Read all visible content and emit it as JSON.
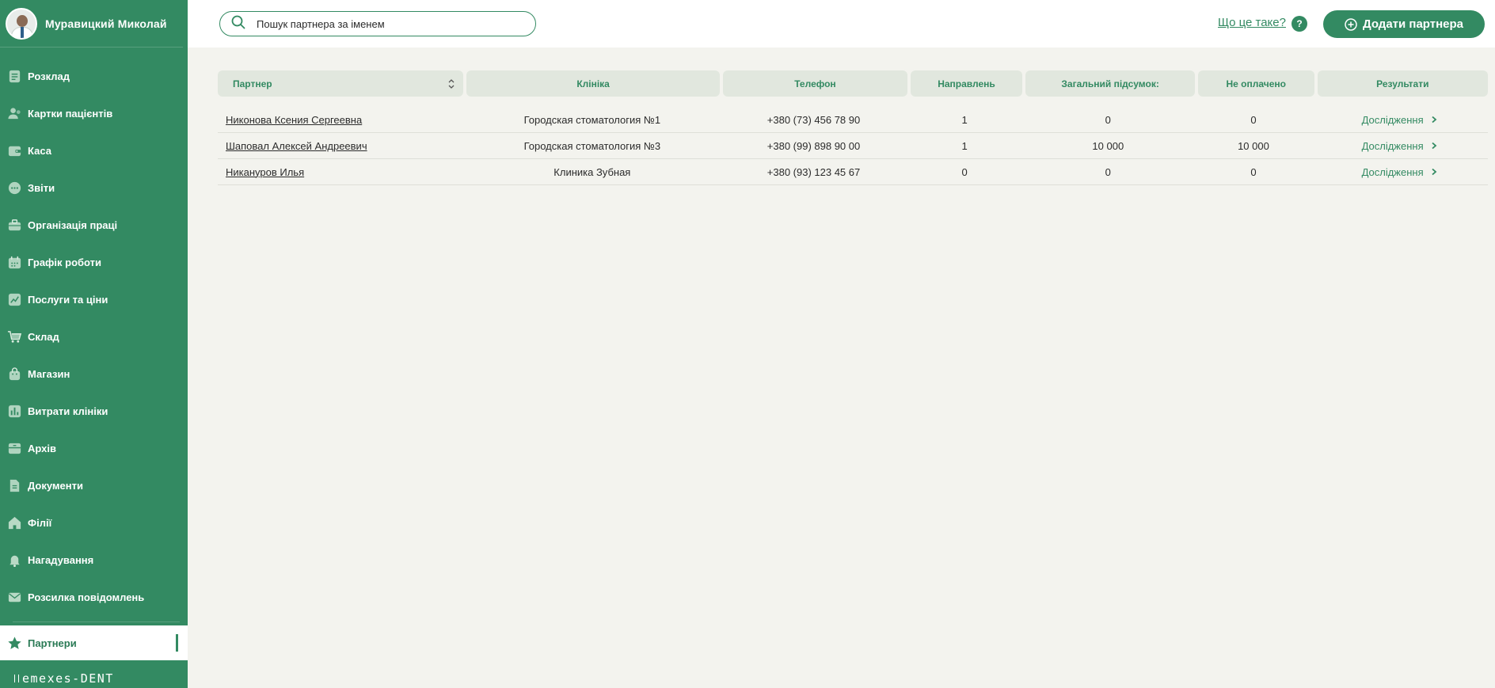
{
  "user": {
    "name": "Муравицкий Миколай"
  },
  "sidebar": {
    "items": [
      {
        "label": "Розклад",
        "icon": "schedule-icon"
      },
      {
        "label": "Картки пацієнтів",
        "icon": "patients-icon"
      },
      {
        "label": "Каса",
        "icon": "wallet-icon"
      },
      {
        "label": "Звіти",
        "icon": "reports-icon"
      },
      {
        "label": "Організація праці",
        "icon": "briefcase-icon"
      },
      {
        "label": "Графік роботи",
        "icon": "calendar-icon"
      },
      {
        "label": "Послуги та ціни",
        "icon": "chart-up-icon"
      },
      {
        "label": "Склад",
        "icon": "cart-icon"
      },
      {
        "label": "Магазин",
        "icon": "shop-bag-icon"
      },
      {
        "label": "Витрати клініки",
        "icon": "bar-chart-icon"
      },
      {
        "label": "Архів",
        "icon": "archive-icon"
      },
      {
        "label": "Документи",
        "icon": "document-icon"
      },
      {
        "label": "Філії",
        "icon": "home-icon"
      },
      {
        "label": "Нагадування",
        "icon": "bell-icon"
      },
      {
        "label": "Розсилка повідомлень",
        "icon": "mail-icon"
      }
    ],
    "active": {
      "label": "Партнери",
      "icon": "star-icon"
    },
    "brand": "emexes-DENT"
  },
  "header": {
    "search_placeholder": "Пошук партнера за іменем",
    "help_link": "Що це таке?",
    "help_badge": "?",
    "add_button": "Додати партнера"
  },
  "table": {
    "columns": [
      "Партнер",
      "Клініка",
      "Телефон",
      "Направлень",
      "Загальний підсумок:",
      "Не оплачено",
      "Результати"
    ],
    "rows": [
      {
        "partner": "Никонова Ксения Сергеевна",
        "clinic": "Городская стоматология №1",
        "phone": "+380 (73) 456 78 90",
        "referrals": "1",
        "total": "0",
        "unpaid": "0",
        "results": "Дослідження"
      },
      {
        "partner": "Шаповал Алексей Андреевич",
        "clinic": "Городская стоматология №3",
        "phone": "+380 (99) 898 90 00",
        "referrals": "1",
        "total": "10 000",
        "unpaid": "10 000",
        "results": "Дослідження"
      },
      {
        "partner": "Никануров Илья",
        "clinic": "Клиника Зубная",
        "phone": "+380 (93) 123 45 67",
        "referrals": "0",
        "total": "0",
        "unpaid": "0",
        "results": "Дослідження"
      }
    ]
  },
  "colors": {
    "brand_green": "#338a62",
    "header_cell": "#e1e7de",
    "background": "#f3f3ee"
  }
}
